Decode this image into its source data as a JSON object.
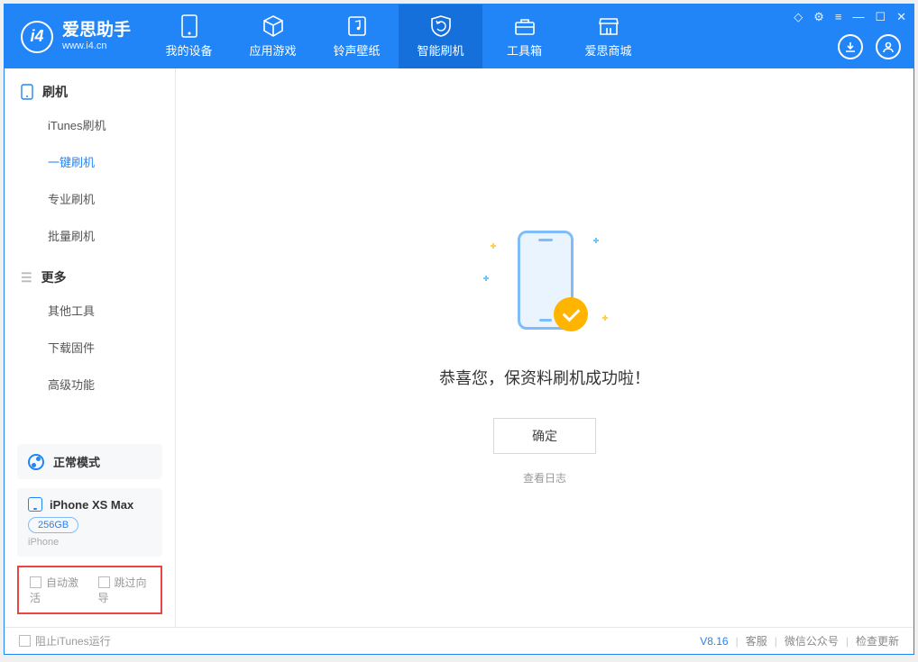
{
  "app": {
    "name": "爱思助手",
    "url": "www.i4.cn"
  },
  "nav": {
    "items": [
      {
        "label": "我的设备"
      },
      {
        "label": "应用游戏"
      },
      {
        "label": "铃声壁纸"
      },
      {
        "label": "智能刷机"
      },
      {
        "label": "工具箱"
      },
      {
        "label": "爱思商城"
      }
    ]
  },
  "sidebar": {
    "flash": {
      "header": "刷机",
      "items": [
        {
          "label": "iTunes刷机"
        },
        {
          "label": "一键刷机"
        },
        {
          "label": "专业刷机"
        },
        {
          "label": "批量刷机"
        }
      ]
    },
    "more": {
      "header": "更多",
      "items": [
        {
          "label": "其他工具"
        },
        {
          "label": "下载固件"
        },
        {
          "label": "高级功能"
        }
      ]
    },
    "mode": "正常模式",
    "device": {
      "name": "iPhone XS Max",
      "capacity": "256GB",
      "type": "iPhone"
    },
    "checks": {
      "auto_activate": "自动激活",
      "skip_guide": "跳过向导"
    }
  },
  "main": {
    "success_text": "恭喜您，保资料刷机成功啦！",
    "ok_button": "确定",
    "view_log": "查看日志"
  },
  "footer": {
    "block_itunes": "阻止iTunes运行",
    "version": "V8.16",
    "links": {
      "service": "客服",
      "wechat": "微信公众号",
      "update": "检查更新"
    }
  }
}
